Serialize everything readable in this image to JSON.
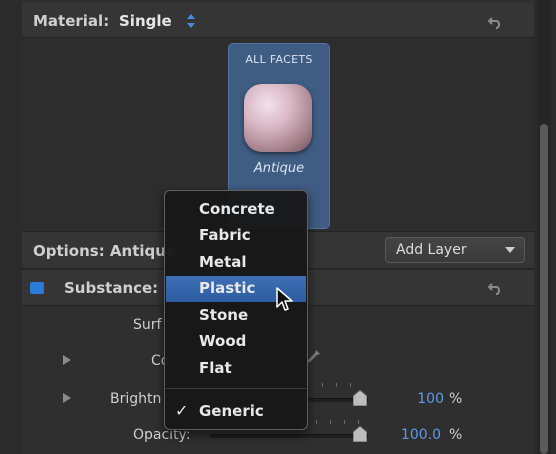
{
  "header": {
    "material_label": "Material:",
    "material_value": "Single"
  },
  "preview": {
    "facet_title": "ALL FACETS",
    "swatch_label": "Antique"
  },
  "options": {
    "label": "Options: Antique",
    "add_layer_label": "Add Layer"
  },
  "substance": {
    "label": "Substance:"
  },
  "properties": {
    "surface_label": "Surf",
    "color_label": "Co",
    "brightness_label": "Brightn",
    "brightness_value": "100",
    "brightness_unit": "%",
    "opacity_label": "Opacity:",
    "opacity_value": "100.0",
    "opacity_unit": "%"
  },
  "menu": {
    "items": [
      "Concrete",
      "Fabric",
      "Metal",
      "Plastic",
      "Stone",
      "Wood",
      "Flat"
    ],
    "selected": "Plastic",
    "checked_item": "Generic",
    "check_symbol": "✓"
  },
  "colors": {
    "accent": "#2c5da3",
    "value_blue": "#5d9be6",
    "facet_card": "#3f5c82"
  }
}
